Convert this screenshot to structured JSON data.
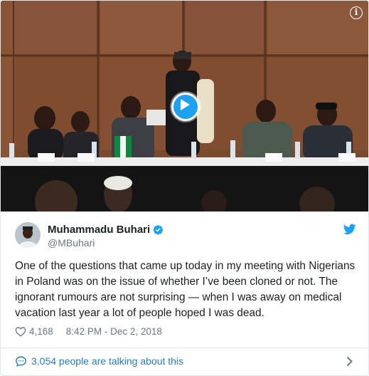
{
  "tweet": {
    "author_name": "Muhammadu Buhari",
    "author_handle": "@MBuhari",
    "text": "One of the questions that came up today in my meeting with Nigerians in Poland was on the issue of whether I’ve been cloned or not. The ignorant rumours are not surprising — when I was away on medical vacation last year a lot of people hoped I was dead.",
    "likes": "4,168",
    "timestamp": "8:42 PM - Dec 2, 2018",
    "talking_text": "3,054 people are talking about this"
  },
  "media": {
    "type": "video",
    "info_label": "i"
  },
  "icons": {
    "play": "play-icon",
    "info": "info-icon",
    "verified": "verified-badge-icon",
    "bird": "twitter-bird-icon",
    "heart": "heart-icon",
    "bubble": "speech-bubble-icon",
    "chevron": "chevron-right-icon"
  },
  "colors": {
    "twitter_blue": "#1da1f2",
    "link_blue": "#2b7bb9",
    "text": "#1c2022",
    "muted": "#697882",
    "border": "#e1e8ed"
  }
}
